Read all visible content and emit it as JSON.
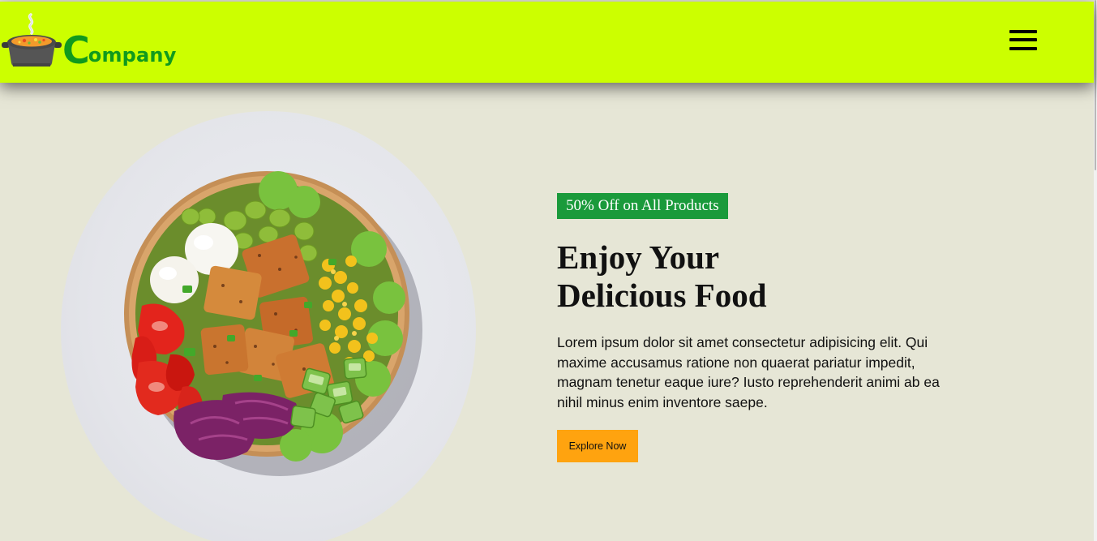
{
  "header": {
    "logo": {
      "first_letter": "C",
      "rest": "ompany",
      "icon": "soup-pot-icon"
    },
    "menu_icon": "hamburger-menu-icon"
  },
  "hero": {
    "badge": "50% Off on All Products",
    "headline_line1": "Enjoy Your",
    "headline_line2": "Delicious Food",
    "description": "Lorem ipsum dolor sit amet consectetur adipisicing elit. Qui maxime accusamus ratione non quaerat pariatur impedit, magnam tenetur eaque iure? Iusto reprehenderit animi ab ea nihil minus enim inventore saepe.",
    "button_label": "Explore Now",
    "image": "salad-bowl-image"
  },
  "colors": {
    "header_bg": "#ccff00",
    "page_bg": "#e6e6d6",
    "brand_green": "#119a1d",
    "badge_bg": "#1a9a3b",
    "button_bg": "#ffa30f"
  }
}
